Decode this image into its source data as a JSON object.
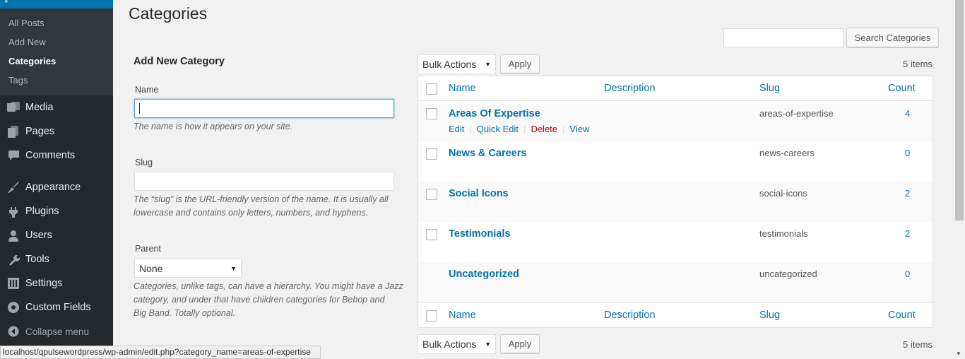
{
  "sidebar": {
    "submenu": [
      {
        "label": "All Posts"
      },
      {
        "label": "Add New"
      },
      {
        "label": "Categories"
      },
      {
        "label": "Tags"
      }
    ],
    "menu": [
      {
        "label": "Media",
        "icon": "media-icon"
      },
      {
        "label": "Pages",
        "icon": "pages-icon"
      },
      {
        "label": "Comments",
        "icon": "comments-icon"
      },
      {
        "label": "Appearance",
        "icon": "appearance-icon"
      },
      {
        "label": "Plugins",
        "icon": "plugins-icon"
      },
      {
        "label": "Users",
        "icon": "users-icon"
      },
      {
        "label": "Tools",
        "icon": "tools-icon"
      },
      {
        "label": "Settings",
        "icon": "settings-icon"
      },
      {
        "label": "Custom Fields",
        "icon": "custom-fields-icon"
      }
    ],
    "collapse": "Collapse menu"
  },
  "page": {
    "title": "Categories",
    "search_button": "Search Categories",
    "search_value": ""
  },
  "form": {
    "title": "Add New Category",
    "name_label": "Name",
    "name_value": "",
    "name_desc": "The name is how it appears on your site.",
    "slug_label": "Slug",
    "slug_desc_1": "The “slug” is the URL-friendly version of the name. It is usually all",
    "slug_desc_2": "lowercase and contains only letters, numbers, and hyphens.",
    "parent_label": "Parent",
    "parent_value": "None",
    "parent_desc_1": "Categories, unlike tags, can have a hierarchy. You might have a Jazz",
    "parent_desc_2": "category, and under that have children categories for Bebop and",
    "parent_desc_3": "Big Band. Totally optional."
  },
  "table": {
    "bulk_actions": "Bulk Actions",
    "apply": "Apply",
    "items_count": "5 items",
    "headers": {
      "name": "Name",
      "description": "Description",
      "slug": "Slug",
      "count": "Count"
    },
    "rows": [
      {
        "name": "Areas Of Expertise",
        "slug": "areas-of-expertise",
        "count": "4"
      },
      {
        "name": "News & Careers",
        "slug": "news-careers",
        "count": "0"
      },
      {
        "name": "Social Icons",
        "slug": "social-icons",
        "count": "2"
      },
      {
        "name": "Testimonials",
        "slug": "testimonials",
        "count": "2"
      },
      {
        "name": "Uncategorized",
        "slug": "uncategorized",
        "count": "0"
      }
    ],
    "row_actions": {
      "edit": "Edit",
      "quick_edit": "Quick Edit",
      "delete": "Delete",
      "view": "View"
    }
  },
  "statusbar": {
    "url": "localhost/qpulsewordpress/wp-admin/edit.php?category_name=areas-of-expertise"
  },
  "colors": {
    "sidebar_bg": "#23282d",
    "submenu_bg": "#32373c",
    "accent": "#0073aa",
    "delete": "#aa0000"
  }
}
